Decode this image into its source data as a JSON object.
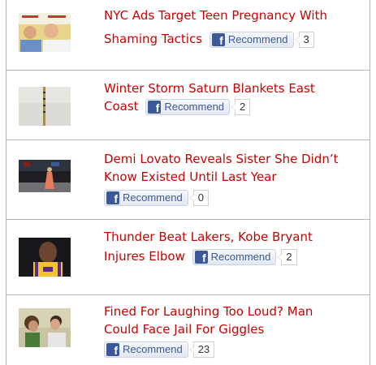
{
  "facebook_button": {
    "icon_letter": "f",
    "label": "Recommend",
    "brand_color": "#3b5998"
  },
  "accent_color": "#cc0000",
  "articles": [
    {
      "title_line1": "NYC Ads Target Teen Pregnancy With",
      "title_line2": "Shaming Tactics",
      "recommend_count": "3"
    },
    {
      "title_line1": "Winter Storm Saturn Blankets East",
      "title_line2": "Coast",
      "recommend_count": "2"
    },
    {
      "title_line1": "Demi Lovato Reveals Sister She Didn’t",
      "title_line2": "Know Existed Until Last Year",
      "recommend_count": "0"
    },
    {
      "title_line1": "Thunder Beat Lakers, Kobe Bryant",
      "title_line2": "Injures Elbow",
      "recommend_count": "2"
    },
    {
      "title_line1": "Fined For Laughing Too Loud? Man",
      "title_line2": "Could Face Jail For Giggles",
      "recommend_count": "23"
    }
  ]
}
